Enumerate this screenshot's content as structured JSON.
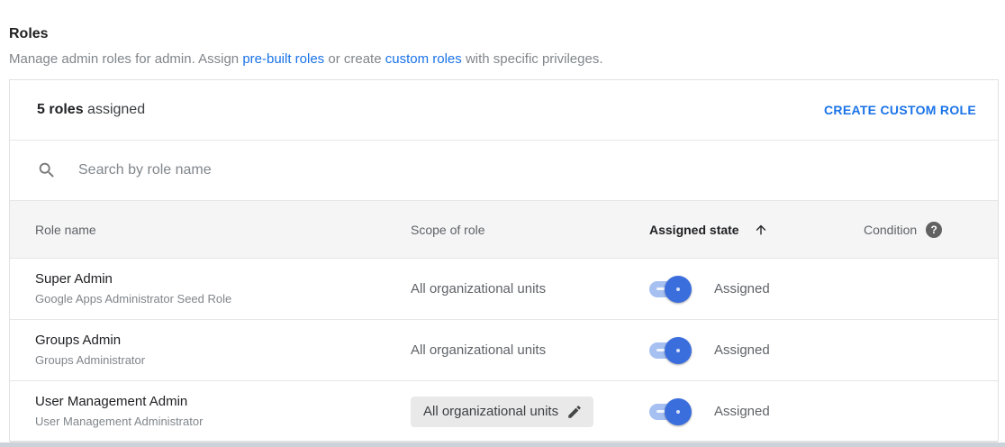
{
  "page": {
    "title": "Roles",
    "subtitle": {
      "part1": "Manage admin roles for admin. Assign",
      "link1": "pre-built roles",
      "part2": "or create",
      "link2": "custom roles",
      "part3": "with specific privileges."
    }
  },
  "panel": {
    "header": {
      "count_bold": "5 roles",
      "count_rest": "assigned",
      "create_button": "CREATE CUSTOM ROLE"
    },
    "search": {
      "placeholder": "Search by role name"
    },
    "table": {
      "columns": {
        "role_name": "Role name",
        "scope": "Scope of role",
        "assigned_state": "Assigned state",
        "condition": "Condition"
      },
      "sort": {
        "column": "Assigned state",
        "direction": "ascending"
      },
      "rows": [
        {
          "name": "Super Admin",
          "description": "Google Apps Administrator Seed Role",
          "scope": "All organizational units",
          "scope_editable": false,
          "assigned": true,
          "state_label": "Assigned"
        },
        {
          "name": "Groups Admin",
          "description": "Groups Administrator",
          "scope": "All organizational units",
          "scope_editable": false,
          "assigned": true,
          "state_label": "Assigned"
        },
        {
          "name": "User Management Admin",
          "description": "User Management Administrator",
          "scope": "All organizational units",
          "scope_editable": true,
          "assigned": true,
          "state_label": "Assigned"
        }
      ]
    }
  },
  "icons": {
    "search": "search-icon",
    "sort_ascending": "arrow-up-icon",
    "condition_help": "help-icon",
    "edit_scope": "pencil-icon"
  },
  "colors": {
    "accent_blue": "#1a73e8",
    "toggle_thumb": "#3b6edd",
    "toggle_track": "#a6c0f1",
    "chip_bg": "#e9e9e9",
    "thead_bg": "#f5f5f5"
  }
}
